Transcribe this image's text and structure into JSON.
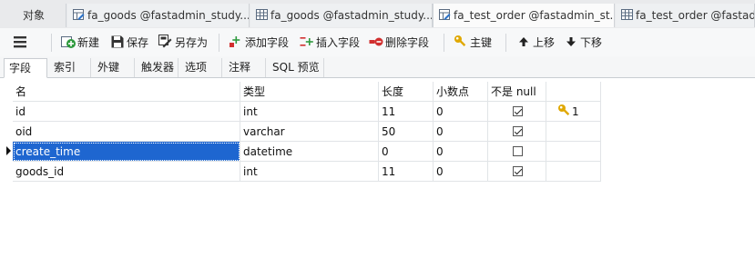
{
  "window_tabs": [
    {
      "label": "对象",
      "icon": "none"
    },
    {
      "label": "fa_goods @fastadmin_study...",
      "icon": "table-design-icon"
    },
    {
      "label": "fa_goods @fastadmin_study...",
      "icon": "table-icon"
    },
    {
      "label": "fa_test_order @fastadmin_st...",
      "icon": "table-design-icon"
    },
    {
      "label": "fa_test_order @fastadm",
      "icon": "table-icon"
    }
  ],
  "toolbar": {
    "new_label": "新建",
    "save_label": "保存",
    "save_as_label": "另存为",
    "add_field_label": "添加字段",
    "insert_field_label": "插入字段",
    "delete_field_label": "删除字段",
    "primary_key_label": "主键",
    "move_up_label": "上移",
    "move_down_label": "下移"
  },
  "subtabs": [
    "字段",
    "索引",
    "外键",
    "触发器",
    "选项",
    "注释",
    "SQL 预览"
  ],
  "grid": {
    "headers": {
      "name": "名",
      "type": "类型",
      "length": "长度",
      "decimal": "小数点",
      "not_null": "不是 null",
      "key": ""
    },
    "rows": [
      {
        "name": "id",
        "type": "int",
        "length": "11",
        "decimal": "0",
        "not_null": true,
        "key": "1"
      },
      {
        "name": "oid",
        "type": "varchar",
        "length": "50",
        "decimal": "0",
        "not_null": true,
        "key": ""
      },
      {
        "name": "create_time",
        "type": "datetime",
        "length": "0",
        "decimal": "0",
        "not_null": false,
        "key": ""
      },
      {
        "name": "goods_id",
        "type": "int",
        "length": "11",
        "decimal": "0",
        "not_null": true,
        "key": ""
      }
    ]
  },
  "colors": {
    "selection": "#1e66d0",
    "accent_green": "#2e9a3e",
    "accent_red": "#d12f2f",
    "key_gold": "#e0a800"
  }
}
